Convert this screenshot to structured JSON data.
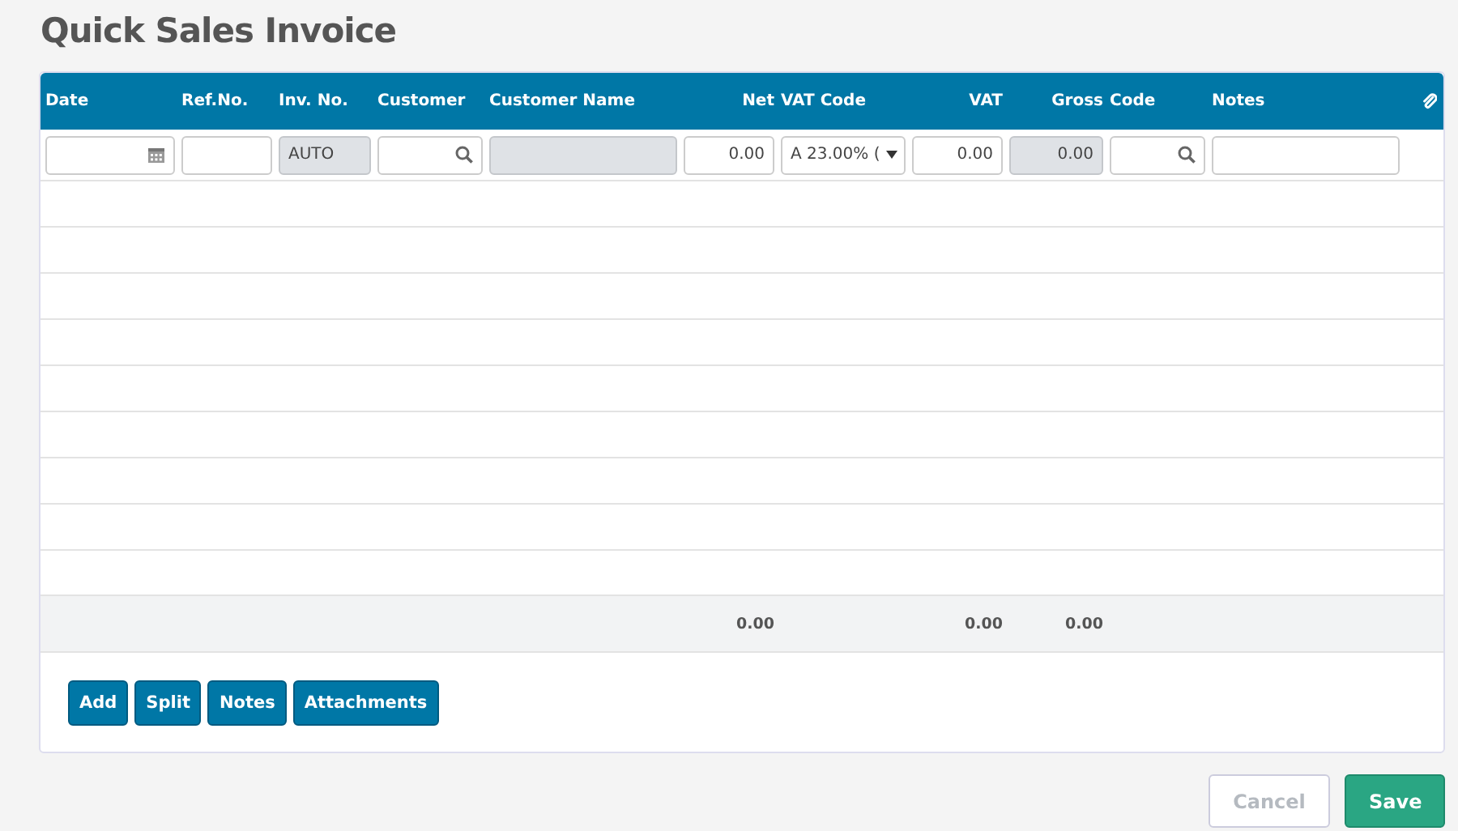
{
  "page_title": "Quick Sales Invoice",
  "table": {
    "columns": [
      {
        "label": "Date",
        "kind": "text"
      },
      {
        "label": "Ref.No.",
        "kind": "text"
      },
      {
        "label": "Inv. No.",
        "kind": "text"
      },
      {
        "label": "Customer",
        "kind": "text"
      },
      {
        "label": "Customer Name",
        "kind": "text"
      },
      {
        "label": "Net",
        "kind": "amount",
        "total": "0.00"
      },
      {
        "label": "VAT Code",
        "kind": "text"
      },
      {
        "label": "VAT",
        "kind": "amount",
        "total": "0.00"
      },
      {
        "label": "Gross",
        "kind": "amount",
        "total": "0.00"
      },
      {
        "label": "Code",
        "kind": "text"
      },
      {
        "label": "Notes",
        "kind": "text"
      },
      {
        "kind": "attachment"
      }
    ],
    "entry_row": [
      {
        "kind": "date",
        "disabled": false
      },
      {
        "kind": "text",
        "disabled": false
      },
      {
        "kind": "text",
        "value": "AUTO",
        "disabled": true
      },
      {
        "kind": "search",
        "disabled": false
      },
      {
        "kind": "text",
        "disabled": true
      },
      {
        "kind": "number",
        "value": "0.00",
        "disabled": false
      },
      {
        "kind": "select",
        "value": "A 23.00% (",
        "disabled": false
      },
      {
        "kind": "number",
        "value": "0.00",
        "disabled": false
      },
      {
        "kind": "number",
        "value": "0.00",
        "disabled": true
      },
      {
        "kind": "search",
        "disabled": false
      },
      {
        "kind": "text",
        "disabled": false
      }
    ]
  },
  "actions": [
    {
      "label": "Add"
    },
    {
      "label": "Split"
    },
    {
      "label": "Notes"
    },
    {
      "label": "Attachments"
    }
  ],
  "footer_buttons": [
    {
      "label": "Cancel",
      "kind": "secondary",
      "disabled": true
    },
    {
      "label": "Save",
      "kind": "primary",
      "disabled": false
    }
  ]
}
